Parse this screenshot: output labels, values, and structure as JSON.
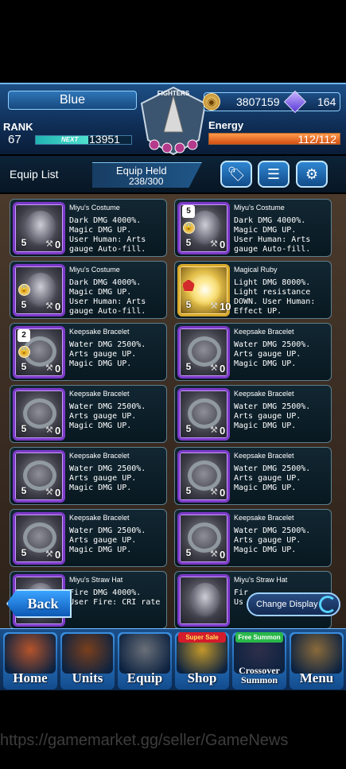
{
  "header": {
    "player_name": "Blue",
    "rank_label": "RANK",
    "rank_value": "67",
    "next_label": "NEXT",
    "next_value": "13951",
    "exp_progress": 0.55,
    "gil": "3807159",
    "lapis": "164",
    "energy_label": "Energy",
    "energy_value": "112/112",
    "energy_progress": 1.0,
    "logo_text": "FIGHTERS"
  },
  "list_bar": {
    "title": "Equip List",
    "held_label": "Equip Held",
    "held_value": "238/300",
    "buttons": [
      "tag-icon",
      "sliders-icon",
      "gear-icon"
    ]
  },
  "cards": [
    {
      "name": "Miyu's Costume",
      "desc": [
        "Dark DMG 4000%.",
        "Magic DMG UP.",
        "User Human: Arts",
        "gauge Auto-fill."
      ],
      "level": "5",
      "upgrades": "0",
      "art": "costume",
      "locked": false,
      "corner": ""
    },
    {
      "name": "Miyu's Costume",
      "desc": [
        "Dark DMG 4000%.",
        "Magic DMG UP.",
        "User Human: Arts",
        "gauge Auto-fill."
      ],
      "level": "5",
      "upgrades": "0",
      "art": "costume",
      "locked": true,
      "corner": "5"
    },
    {
      "name": "Miyu's Costume",
      "desc": [
        "Dark DMG 4000%.",
        "Magic DMG UP.",
        "User Human: Arts",
        "gauge Auto-fill."
      ],
      "level": "5",
      "upgrades": "0",
      "art": "costume",
      "locked": true,
      "corner": ""
    },
    {
      "name": "Magical Ruby",
      "desc": [
        "Light DMG 8000%.",
        "Light resistance",
        "DOWN. User Human:",
        "Effect UP."
      ],
      "level": "5",
      "upgrades": "10",
      "art": "ruby",
      "locked": false,
      "corner": "",
      "badge": true
    },
    {
      "name": "Keepsake Bracelet",
      "desc": [
        "Water DMG 2500%.",
        "Arts gauge UP.",
        "Magic DMG UP."
      ],
      "level": "5",
      "upgrades": "0",
      "art": "bracelet",
      "locked": true,
      "corner": "2"
    },
    {
      "name": "Keepsake Bracelet",
      "desc": [
        "Water DMG 2500%.",
        "Arts gauge UP.",
        "Magic DMG UP."
      ],
      "level": "5",
      "upgrades": "0",
      "art": "bracelet",
      "locked": false,
      "corner": ""
    },
    {
      "name": "Keepsake Bracelet",
      "desc": [
        "Water DMG 2500%.",
        "Arts gauge UP.",
        "Magic DMG UP."
      ],
      "level": "5",
      "upgrades": "0",
      "art": "bracelet",
      "locked": false,
      "corner": ""
    },
    {
      "name": "Keepsake Bracelet",
      "desc": [
        "Water DMG 2500%.",
        "Arts gauge UP.",
        "Magic DMG UP."
      ],
      "level": "5",
      "upgrades": "0",
      "art": "bracelet",
      "locked": false,
      "corner": ""
    },
    {
      "name": "Keepsake Bracelet",
      "desc": [
        "Water DMG 2500%.",
        "Arts gauge UP.",
        "Magic DMG UP."
      ],
      "level": "5",
      "upgrades": "0",
      "art": "bracelet",
      "locked": false,
      "corner": ""
    },
    {
      "name": "Keepsake Bracelet",
      "desc": [
        "Water DMG 2500%.",
        "Arts gauge UP.",
        "Magic DMG UP."
      ],
      "level": "5",
      "upgrades": "0",
      "art": "bracelet",
      "locked": false,
      "corner": ""
    },
    {
      "name": "Keepsake Bracelet",
      "desc": [
        "Water DMG 2500%.",
        "Arts gauge UP.",
        "Magic DMG UP."
      ],
      "level": "5",
      "upgrades": "0",
      "art": "bracelet",
      "locked": false,
      "corner": ""
    },
    {
      "name": "Keepsake Bracelet",
      "desc": [
        "Water DMG 2500%.",
        "Arts gauge UP.",
        "Magic DMG UP."
      ],
      "level": "5",
      "upgrades": "0",
      "art": "bracelet",
      "locked": false,
      "corner": ""
    },
    {
      "name": "Miyu's Straw Hat",
      "desc": [
        "Fire DMG 4000%.",
        "User Fire: CRI rate"
      ],
      "level": "",
      "upgrades": "",
      "art": "costume",
      "locked": false,
      "corner": ""
    },
    {
      "name": "Miyu's Straw Hat",
      "desc": [
        "Fir",
        "Us"
      ],
      "level": "",
      "upgrades": "",
      "art": "costume",
      "locked": false,
      "corner": ""
    }
  ],
  "buttons": {
    "back": "Back",
    "change_display": "Change Display"
  },
  "nav": [
    {
      "label": "Home",
      "badge": "",
      "art": "#b5542b"
    },
    {
      "label": "Units",
      "badge": "",
      "art": "#7a3f1c"
    },
    {
      "label": "Equip",
      "badge": "",
      "art": "#6a6f78"
    },
    {
      "label": "Shop",
      "badge": "Super Sale",
      "art": "#c3982a"
    },
    {
      "label": "Crossover Summon",
      "badge": "Free Summon",
      "art": "#2f2f4a"
    },
    {
      "label": "Menu",
      "badge": "",
      "art": "#8a6a3a"
    }
  ],
  "watermark": "https://gamemarket.gg/seller/GameNews"
}
